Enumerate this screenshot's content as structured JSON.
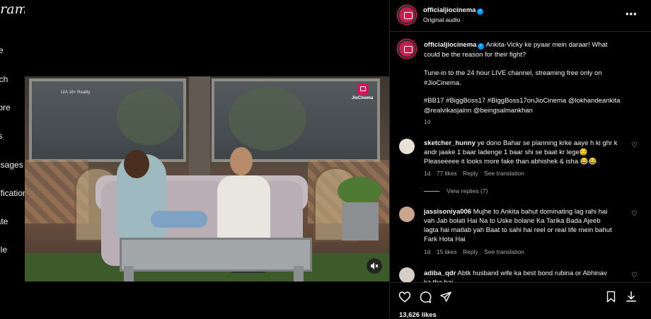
{
  "left_nav": {
    "brand": "gram",
    "items": [
      {
        "label": "me"
      },
      {
        "label": "arch"
      },
      {
        "label": "plore"
      },
      {
        "label": "els"
      },
      {
        "label": "essages"
      },
      {
        "label": "otification"
      },
      {
        "label": "eate"
      },
      {
        "label": "ofile"
      }
    ]
  },
  "video": {
    "overlay_rating": "U/A 16+  Reality",
    "channel_logo_text": "JioCinema"
  },
  "post_header": {
    "username": "officialjiocinema",
    "subtitle": "Original audio"
  },
  "caption": {
    "username": "officialjiocinema",
    "line1": "Ankita-Vicky ke pyaar mein daraar! What",
    "line2": "could be the reason for their fight?",
    "line3": "Tune-in to the 24 hour LIVE channel, streaming free only on",
    "line4": "#JioCinema.",
    "line5": "#BB17 #BiggBoss17 #BiggBoss17onJioCinema @lokhandeankita",
    "line6": "@realvikasjainn @beingsalmankhan",
    "time": "1d"
  },
  "comments": [
    {
      "username": "sketcher_hunny",
      "line1": "ye dono Bahar se planning krke aaye h ki ghr k",
      "line2": "andr jaake 1 baar ladenge 1 baar shi se baat kr lege😏",
      "line3": "Pleaseeeee it looks more fake than abhishek & isha 😂😂",
      "time": "1d",
      "likes": "77 likes",
      "reply": "Reply",
      "translate": "See translation",
      "view_replies": "View replies (7)"
    },
    {
      "username": "jassisoniya006",
      "line1": "Mujhe to Ankita bahut dominating lag rahi hai",
      "line2": "vah Jab bolati Hai Na to Uske bolane Ka Tarika Bada Ajeeb",
      "line3": "lagta hai matlab yah Baat to sahi hai reel or real life mein bahut",
      "line4": "Fark Hota Hai",
      "time": "1d",
      "likes": "15 likes",
      "reply": "Reply",
      "translate": "See translation"
    },
    {
      "username": "adiba_qdr",
      "line1": "Abtk husband wife ka best bond rubina or Abhinav",
      "line2": "ka tha hai"
    }
  ],
  "actions": {
    "likes_count": "13,626 likes"
  },
  "colors": {
    "background": "#000000",
    "verified_blue": "#0095f6",
    "brand_pink": "#c31e4f",
    "muted_text": "#a8a8a8"
  }
}
